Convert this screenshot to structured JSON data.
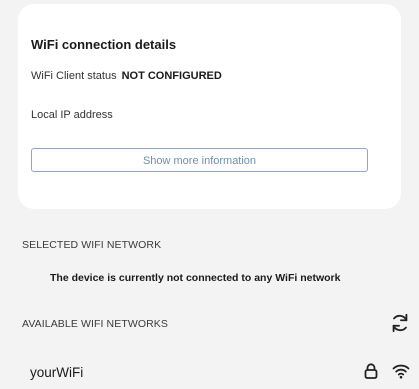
{
  "details": {
    "title": "WiFi connection details",
    "status_label": "WiFi Client status",
    "status_value": "NOT CONFIGURED",
    "ip_label": "Local IP address",
    "more_button": "Show more information"
  },
  "selected_section": {
    "label": "SELECTED WIFI NETWORK",
    "notice": "The device is currently not connected to any WiFi network"
  },
  "available_section": {
    "label": "AVAILABLE WIFI NETWORKS",
    "refresh_icon": "refresh-icon",
    "networks": [
      {
        "name": "yourWiFi",
        "secured_icon": "lock-icon",
        "signal_icon": "wifi-signal-icon"
      }
    ]
  }
}
